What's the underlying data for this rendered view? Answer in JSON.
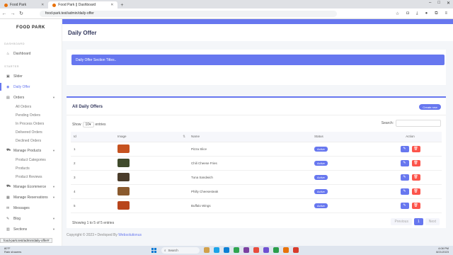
{
  "browser": {
    "tabs": [
      {
        "title": "Food Park"
      },
      {
        "title": "Food Park || Dashboard"
      }
    ],
    "new_tab": "+",
    "url": "food-park.test/admin/daily-offer",
    "status_url": "food-park.test/admin/daily-offer#"
  },
  "sidebar": {
    "brand": "FOOD PARK",
    "section_dashboard": "DASHBOARD",
    "dashboard": "Dashboard",
    "section_starter": "STARTER",
    "items": [
      {
        "label": "Slider",
        "icon": "image-icon"
      },
      {
        "label": "Daily Offer",
        "icon": "tag-icon",
        "active": true
      },
      {
        "label": "Orders",
        "icon": "box-icon",
        "expandable": true
      }
    ],
    "order_subitems": [
      "All Orders",
      "Pending Orders",
      "In Process Orders",
      "Delivered Orders",
      "Declined Orders"
    ],
    "manage_products": "Manage Products",
    "product_subitems": [
      "Product Categories",
      "Products",
      "Product Reviews"
    ],
    "more_items": [
      "Manage Ecommerce",
      "Manage Reservations",
      "Messages",
      "Blog",
      "Sections"
    ]
  },
  "main": {
    "page_title": "Daily Offer",
    "section_title_card": "Daily Offer Section Titles..",
    "card_title": "All Daily Offers",
    "create_button": "Create new",
    "show_label": "Show",
    "show_value": "10",
    "entries_label": "entries",
    "search_label": "Search:",
    "columns": [
      "Id",
      "Image",
      "Name",
      "Status",
      "Action"
    ],
    "rows": [
      {
        "id": "1",
        "name": "Pizza Slice",
        "status": "Active",
        "thumb": "#c6521f"
      },
      {
        "id": "2",
        "name": "Chili Cheese Fries",
        "status": "Active",
        "thumb": "#3f4a2b"
      },
      {
        "id": "3",
        "name": "Tuna Sandwich",
        "status": "Active",
        "thumb": "#4a3c2a"
      },
      {
        "id": "4",
        "name": "Philly Cheesesteak",
        "status": "Active",
        "thumb": "#8a5a2e"
      },
      {
        "id": "5",
        "name": "Buffalo Wings",
        "status": "Active",
        "thumb": "#b8451c"
      }
    ],
    "info": "Showing 1 to 5 of 5 entries",
    "pager": {
      "prev": "Previous",
      "current": "1",
      "next": "Next"
    },
    "footer_text": "Copyright © 2023 •  Devloped By",
    "footer_link": "Websolutionus"
  },
  "taskbar": {
    "weather_temp": "80°F",
    "weather_desc": "Rain showers",
    "search_placeholder": "Search",
    "time": "4:08 PM",
    "date": "8/21/2023"
  },
  "colors": {
    "accent": "#6777ef",
    "danger": "#fc544b"
  }
}
